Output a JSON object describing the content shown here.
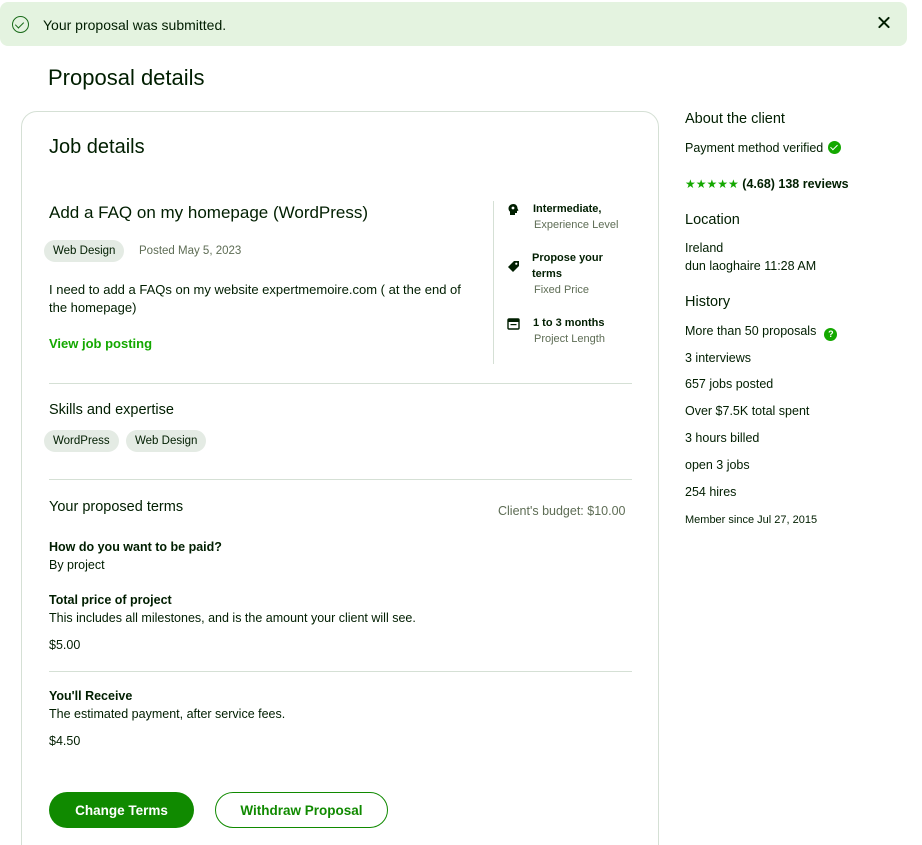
{
  "banner": {
    "message": "Your proposal was submitted."
  },
  "page": {
    "title": "Proposal details"
  },
  "job": {
    "section_title": "Job details",
    "title": "Add a FAQ on my homepage (WordPress)",
    "category": "Web Design",
    "posted": "Posted May 5, 2023",
    "description": "I need to add a FAQs on my website expertmemoire.com ( at the end of the homepage)",
    "view_link": "View job posting",
    "facts": [
      {
        "icon": "brain-icon",
        "main": "Intermediate,",
        "sub": "Experience Level"
      },
      {
        "icon": "tag-icon",
        "main": "Propose your terms",
        "sub": "Fixed Price"
      },
      {
        "icon": "calendar-icon",
        "main": "1 to 3 months",
        "sub": "Project Length"
      }
    ]
  },
  "skills": {
    "title": "Skills and expertise",
    "items": [
      "WordPress",
      "Web Design"
    ]
  },
  "terms": {
    "title": "Your proposed terms",
    "budget": "Client's budget: $10.00",
    "paid_question": "How do you want to be paid?",
    "paid_answer": "By project",
    "total_label": "Total price of project",
    "total_desc": "This includes all milestones, and is the amount your client will see.",
    "total_value": "$5.00",
    "receive_label": "You'll Receive",
    "receive_desc": "The estimated payment, after service fees.",
    "receive_value": "$4.50"
  },
  "actions": {
    "primary": "Change Terms",
    "secondary": "Withdraw Proposal"
  },
  "client": {
    "title": "About the client",
    "payment": "Payment method verified",
    "stars": "★★★★★",
    "rating": 4.68,
    "rating_text": "(4.68) 138 reviews",
    "location_title": "Location",
    "country": "Ireland",
    "city_time": "dun laoghaire 11:28 AM",
    "history_title": "History",
    "proposals": "More than 50 proposals",
    "interviews": "3 interviews",
    "jobs_posted": "657 jobs posted",
    "spent": "Over $7.5K total spent",
    "hours": "3 hours billed",
    "open_jobs": "open 3 jobs",
    "hires": "254 hires",
    "member_since": "Member since Jul 27, 2015"
  },
  "colors": {
    "accent": "#108a00",
    "banner_bg": "#e4f3e0",
    "text": "#001e00",
    "muted": "#5e6d55"
  }
}
